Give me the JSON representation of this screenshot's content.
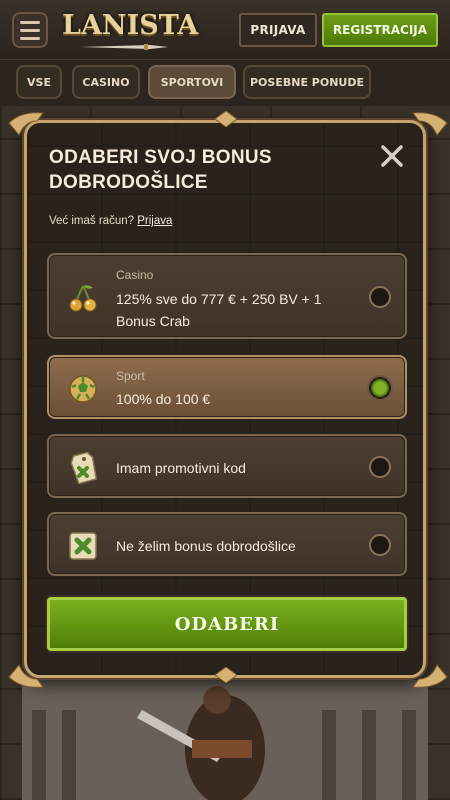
{
  "header": {
    "logo_text": "LANISTA",
    "login_label": "PRIJAVA",
    "register_label": "REGISTRACIJA"
  },
  "nav": {
    "tabs": [
      {
        "label": "VSE",
        "active": false
      },
      {
        "label": "CASINO",
        "active": false
      },
      {
        "label": "SPORTOVI",
        "active": true
      },
      {
        "label": "POSEBNE PONUDE",
        "active": false
      }
    ]
  },
  "modal": {
    "title": "ODABERI SVOJ BONUS DOBRODOŠLICE",
    "login_prompt": "Već imaš račun?",
    "login_link": "Prijava",
    "options": [
      {
        "category": "Casino",
        "description": "125% sve do 777 € + 250 BV + 1 Bonus Crab",
        "icon": "cherries-icon",
        "selected": false
      },
      {
        "category": "Sport",
        "description": "100% do 100 €",
        "icon": "soccer-ball-icon",
        "selected": true
      },
      {
        "category": "",
        "description": "Imam promotivni kod",
        "icon": "promo-tag-icon",
        "selected": false
      },
      {
        "category": "",
        "description": "Ne želim bonus dobrodošlice",
        "icon": "clover-card-icon",
        "selected": false
      }
    ],
    "submit_label": "ODABERI"
  },
  "colors": {
    "accent_green": "#6f9d16",
    "gold_border": "#c6a56c",
    "selected_option": "#8e6d4c"
  }
}
